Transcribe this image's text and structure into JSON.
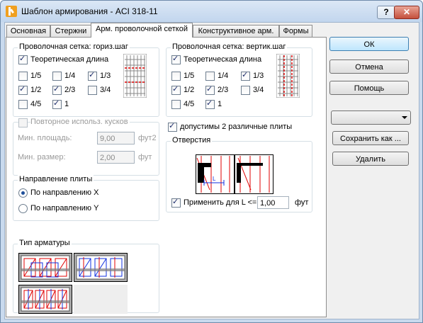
{
  "window": {
    "title": "Шаблон армирования - ACI 318-11",
    "help_label": "?",
    "close_label": "✕"
  },
  "tabs": [
    {
      "label": "Основная"
    },
    {
      "label": "Стержни"
    },
    {
      "label": "Арм. проволочной сеткой"
    },
    {
      "label": "Конструктивное арм."
    },
    {
      "label": "Формы"
    }
  ],
  "horiz_group": {
    "legend": "Проволочная сетка: гориз.шаг",
    "theoretical": {
      "label": "Теоретическая длина",
      "checked": true
    },
    "fractions": [
      {
        "label": "1/5",
        "checked": false
      },
      {
        "label": "1/4",
        "checked": false
      },
      {
        "label": "1/3",
        "checked": true
      },
      {
        "label": "1/2",
        "checked": true
      },
      {
        "label": "2/3",
        "checked": true
      },
      {
        "label": "3/4",
        "checked": false
      },
      {
        "label": "4/5",
        "checked": false
      },
      {
        "label": "1",
        "checked": true
      }
    ]
  },
  "vert_group": {
    "legend": "Проволочная сетка: вертик.шаг",
    "theoretical": {
      "label": "Теоретическая длина",
      "checked": true
    },
    "fractions": [
      {
        "label": "1/5",
        "checked": false
      },
      {
        "label": "1/4",
        "checked": false
      },
      {
        "label": "1/3",
        "checked": true
      },
      {
        "label": "1/2",
        "checked": true
      },
      {
        "label": "2/3",
        "checked": true
      },
      {
        "label": "3/4",
        "checked": false
      },
      {
        "label": "4/5",
        "checked": false
      },
      {
        "label": "1",
        "checked": true
      }
    ]
  },
  "reuse_group": {
    "legend": "Повторное использ. кусков",
    "min_area_label": "Мин. площадь:",
    "min_area_value": "9,00",
    "min_area_unit": "фут2",
    "min_size_label": "Мин. размер:",
    "min_size_value": "2,00",
    "min_size_unit": "фут"
  },
  "two_plates": {
    "label": "допустимы 2 различные плиты",
    "checked": true
  },
  "direction_group": {
    "legend": "Направление плиты",
    "option_x": "По направлению X",
    "option_y": "По направлению Y",
    "selected": "X"
  },
  "openings_group": {
    "legend": "Отверстия",
    "apply_label": "Применить для L <=",
    "apply_checked": true,
    "apply_value": "1,00",
    "apply_unit": "фут"
  },
  "rebar_type_group": {
    "legend": "Тип арматуры"
  },
  "buttons": {
    "ok": "ОК",
    "cancel": "Отмена",
    "help": "Помощь",
    "save_as": "Сохранить как ...",
    "delete": "Удалить"
  },
  "combo": {
    "value": ""
  },
  "colors": {
    "mesh_red": "#e00000",
    "mesh_blue": "#1030e0",
    "mesh_gray": "#7c7c7c"
  }
}
